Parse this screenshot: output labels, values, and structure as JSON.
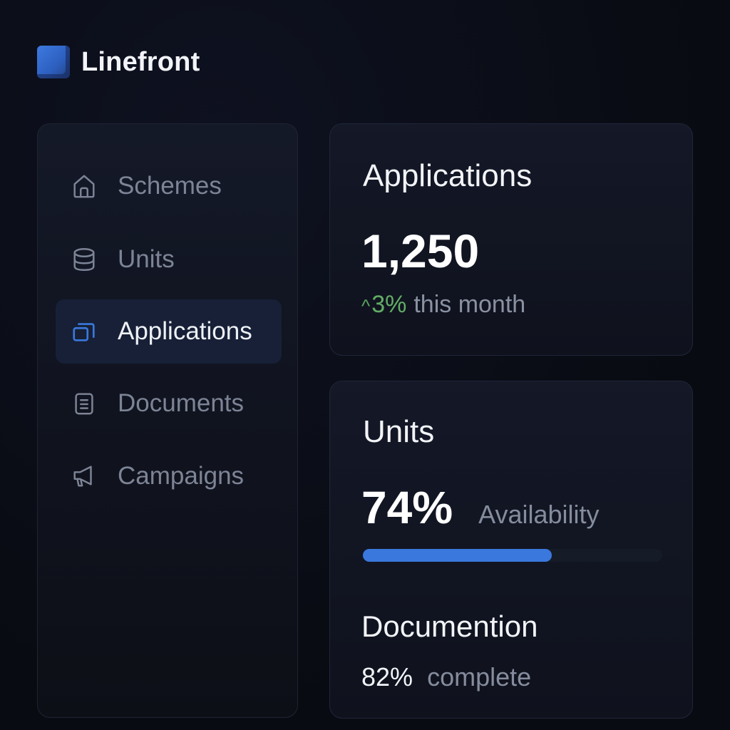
{
  "brand": {
    "name": "Linefront",
    "logo_color": "#3d7ae0"
  },
  "sidebar": {
    "items": [
      {
        "label": "Schemes",
        "icon": "home-icon",
        "active": false
      },
      {
        "label": "Units",
        "icon": "database-icon",
        "active": false
      },
      {
        "label": "Applications",
        "icon": "applications-icon",
        "active": true
      },
      {
        "label": "Documents",
        "icon": "document-icon",
        "active": false
      },
      {
        "label": "Campaigns",
        "icon": "megaphone-icon",
        "active": false
      }
    ]
  },
  "cards": {
    "applications": {
      "title": "Applications",
      "value": "1,250",
      "trend_arrow": "^",
      "trend_value": "3%",
      "trend_text": "this month"
    },
    "units": {
      "title": "Units",
      "value": "74%",
      "label": "Availability",
      "progress": 0.63,
      "documentation": {
        "title": "Documention",
        "value": "82%",
        "label": "complete"
      }
    }
  },
  "colors": {
    "accent": "#3a78dd",
    "positive": "#62ad66",
    "muted_text": "#7d8496",
    "active_bg": "#172036"
  }
}
